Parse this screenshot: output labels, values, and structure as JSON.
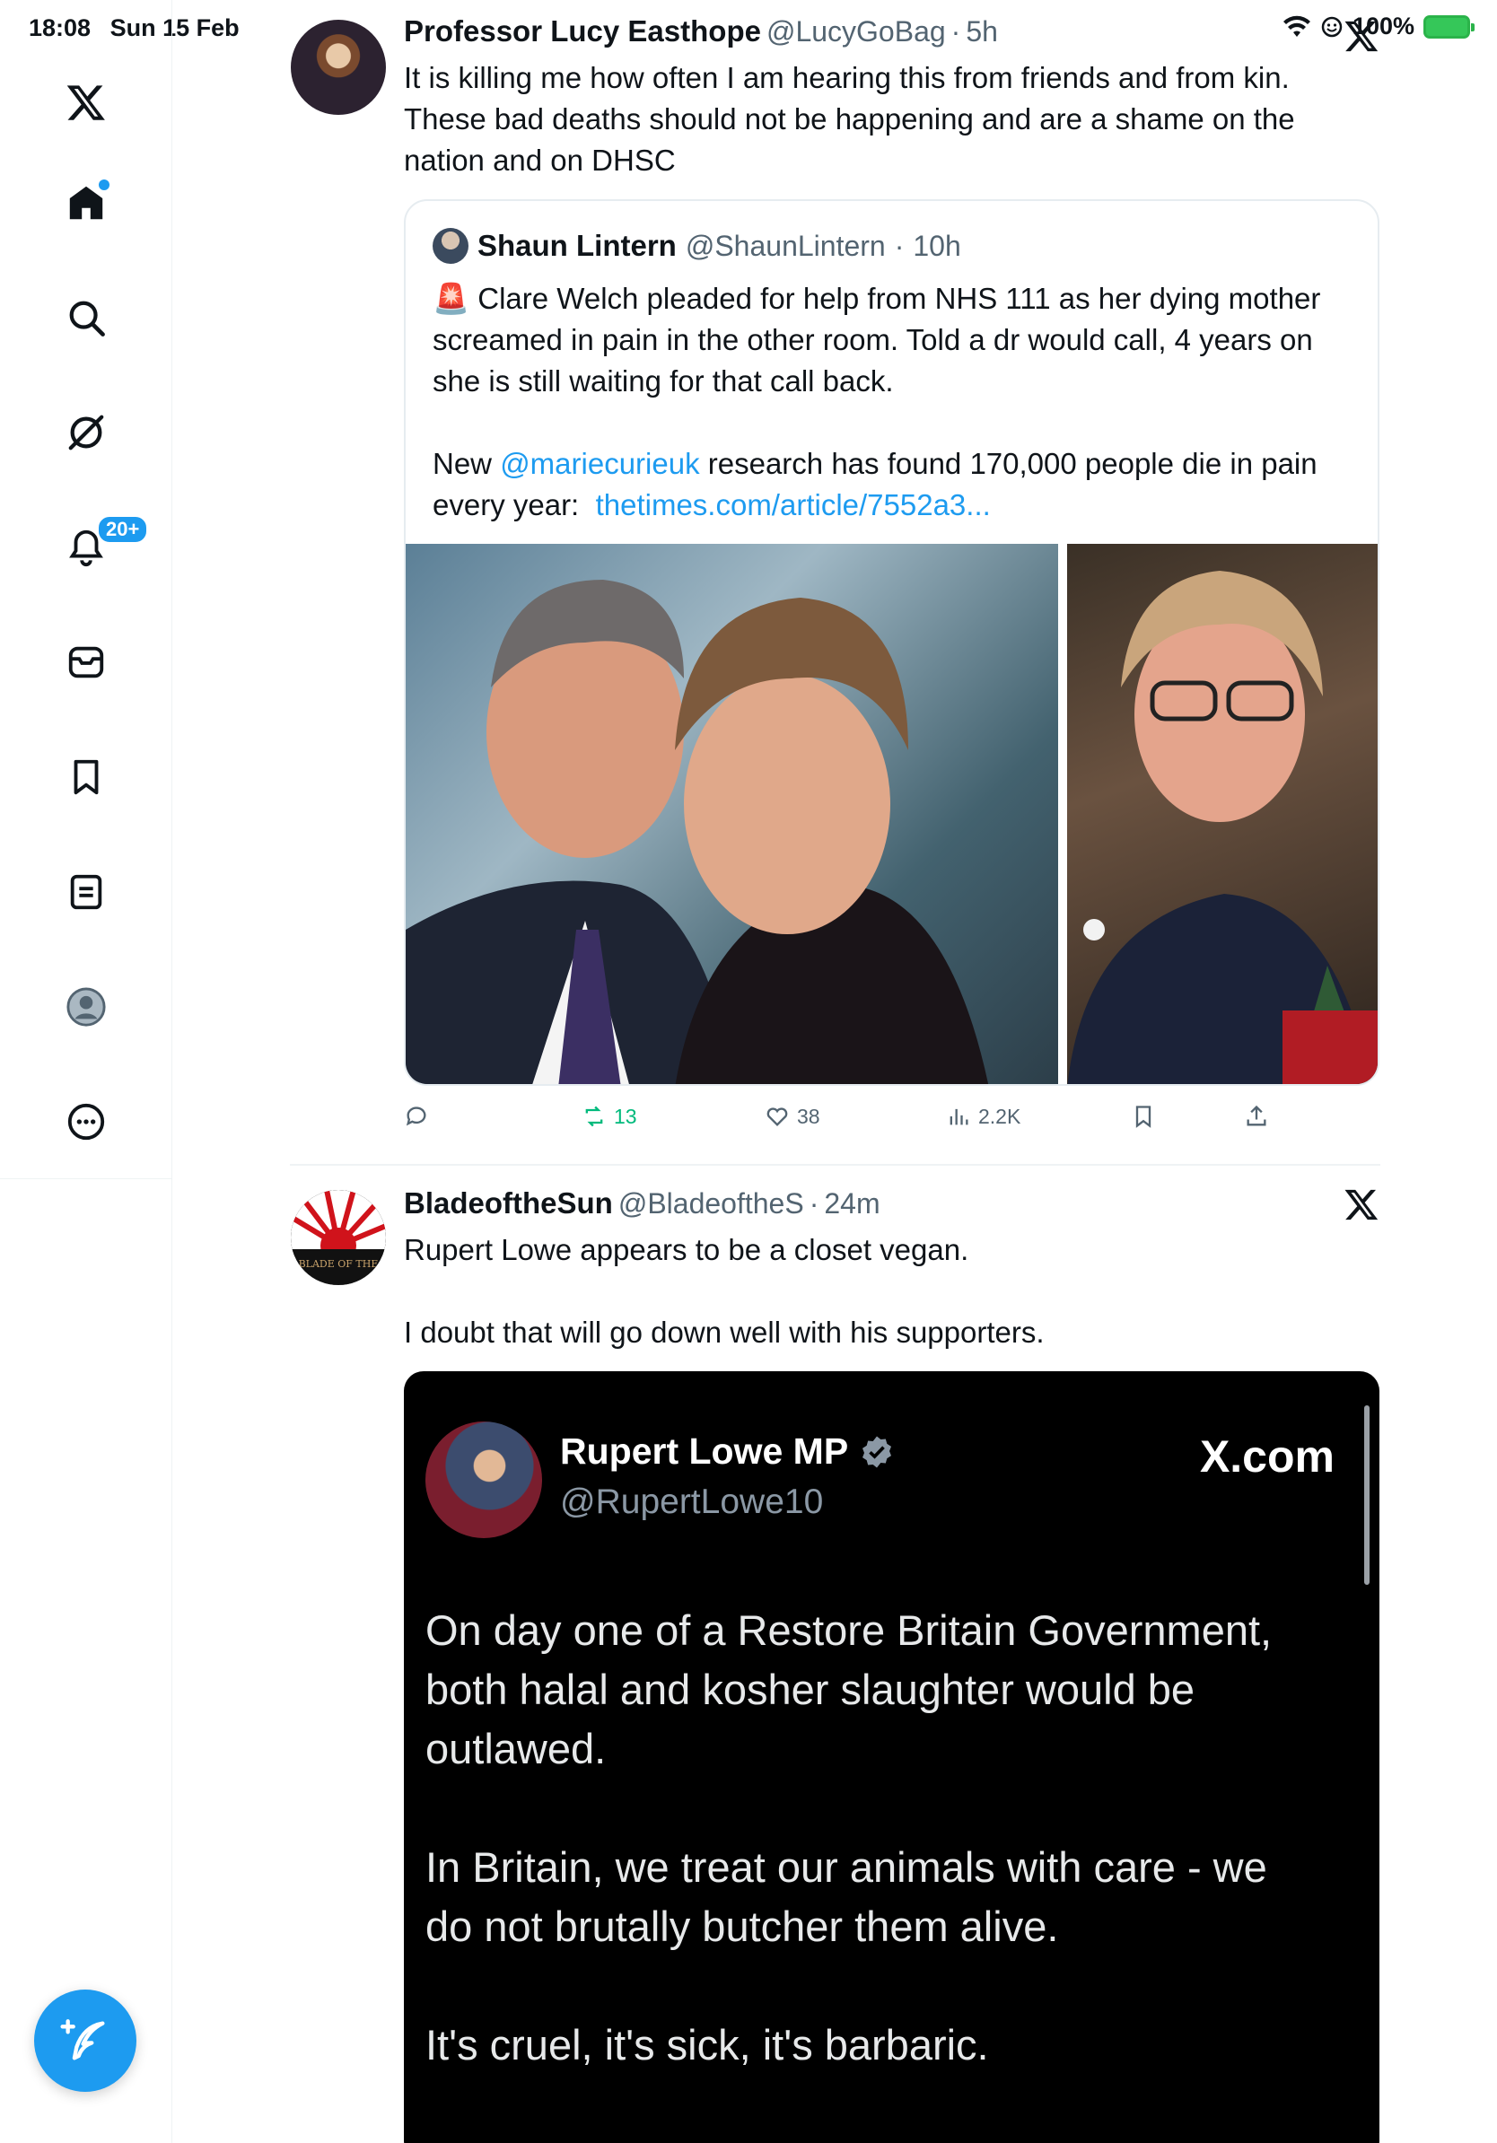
{
  "status_bar": {
    "time": "18:08",
    "date": "Sun 15 Feb",
    "battery": "100%"
  },
  "sidebar": {
    "items": [
      {
        "name": "x-logo-icon",
        "label": ""
      },
      {
        "name": "home-icon",
        "label": ""
      },
      {
        "name": "search-icon",
        "label": ""
      },
      {
        "name": "grok-icon",
        "label": ""
      },
      {
        "name": "notifications-icon",
        "label": "",
        "badge": "20+"
      },
      {
        "name": "messages-icon",
        "label": ""
      },
      {
        "name": "bookmarks-icon",
        "label": ""
      },
      {
        "name": "lists-icon",
        "label": ""
      },
      {
        "name": "profile-icon",
        "label": ""
      },
      {
        "name": "more-icon",
        "label": ""
      }
    ],
    "accent": "#1d9bf0"
  },
  "tweet1": {
    "name": "Professor Lucy Easthope",
    "handle": "@LucyGoBag",
    "sep": "·",
    "time": "5h",
    "text": "It is killing me how often I am hearing this from friends and from kin.\nThese bad deaths should not be happening and are a shame on the\nnation and on DHSC",
    "quote": {
      "name": "Shaun Lintern",
      "handle": "@ShaunLintern",
      "sep": "·",
      "time": "10h",
      "text_part1": "🚨 Clare Welch pleaded for help from NHS 111 as her dying mother\nscreamed in pain in the other room. Told a dr would call, 4 years on\nshe is still waiting for that call back.\n\nNew ",
      "mention": "@mariecurieuk",
      "text_part2": " research has found 170,000 people die in pain\nevery year:  ",
      "link": "thetimes.com/article/7552a3..."
    },
    "actions": {
      "reply": "",
      "retweet": "13",
      "like": "38",
      "views": "2.2K"
    }
  },
  "tweet2": {
    "name": "BladeoftheSun",
    "handle": "@BladeoftheS",
    "sep": "·",
    "time": "24m",
    "text": "Rupert Lowe appears to be a closet vegan.\n\nI doubt that will go down well with his supporters.",
    "avatar_text": "BLADE OF THE",
    "media": {
      "name": "Rupert Lowe MP",
      "handle": "@RupertLowe10",
      "brand": "X.com",
      "text": "On day one of a Restore Britain Government,\nboth halal and kosher slaughter would be\noutlawed.\n\nIn Britain, we treat our animals with care - we\ndo not brutally butcher them alive.\n\nIt's cruel, it's sick, it's barbaric."
    }
  },
  "colors": {
    "retweet_green": "#00ba7c",
    "muted": "#536471",
    "link": "#1d9bf0"
  }
}
